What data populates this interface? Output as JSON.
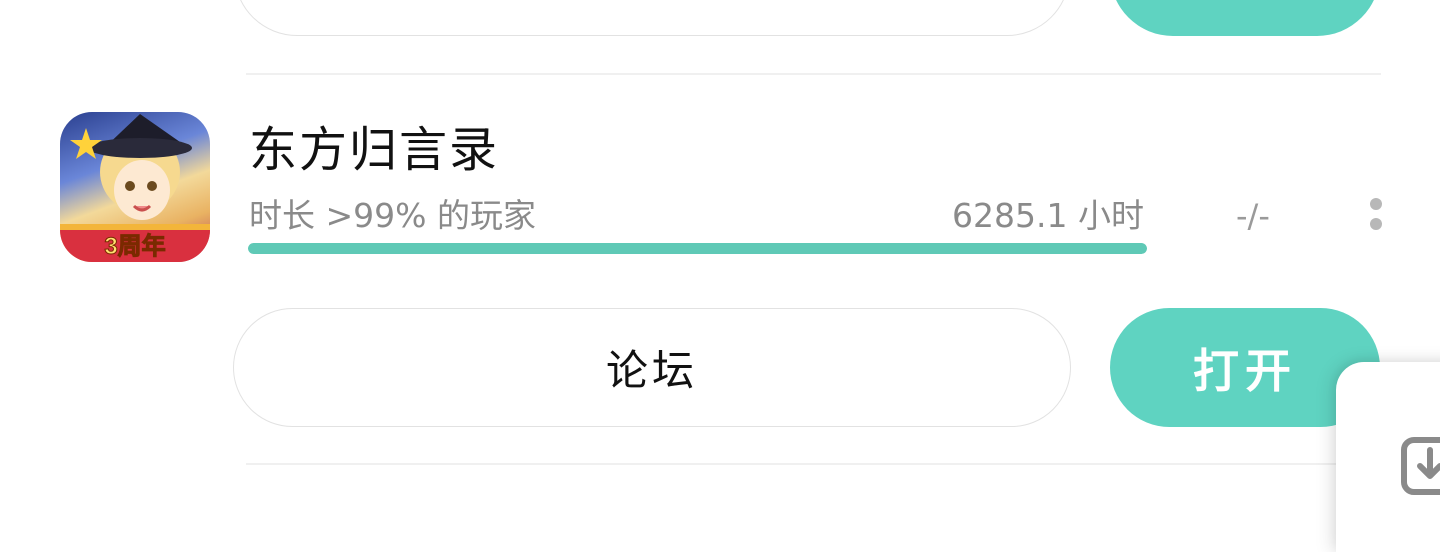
{
  "game": {
    "title": "东方归言录",
    "icon": "touhou-lostword-3rd-anniversary-icon",
    "icon_badge_text": "3周年",
    "playtime_label": "时长 >99% 的玩家",
    "playtime_hours": "6285.1 小时",
    "progress_fraction": 1.0,
    "achievement_ratio": "-/-"
  },
  "buttons": {
    "forum_label": "论坛",
    "open_label": "打开"
  },
  "icons": {
    "more": "more-vertical-icon",
    "download": "download-icon"
  },
  "colors": {
    "accent": "#5fd3c1",
    "progress": "#5fc9b6",
    "title_text": "#111111",
    "secondary_text": "#8a8a8a"
  }
}
